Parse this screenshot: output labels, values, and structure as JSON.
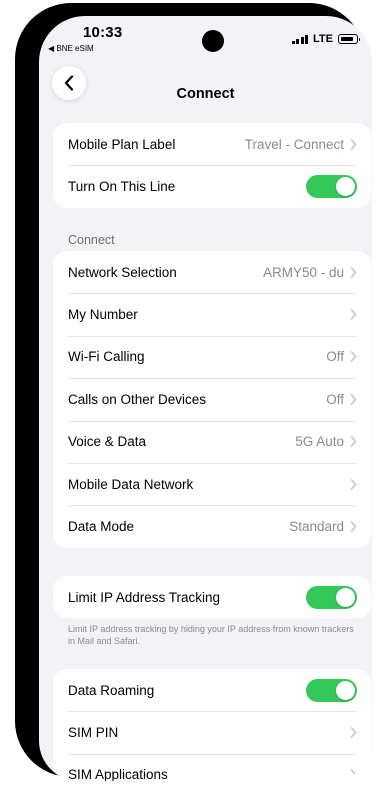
{
  "status_bar": {
    "time": "10:33",
    "back_app": "◀ BNE eSIM",
    "network": "LTE"
  },
  "nav": {
    "title": "Connect",
    "back_icon": "chevron-left-icon"
  },
  "plan_group": [
    {
      "label": "Mobile Plan Label",
      "value": "Travel - Connect",
      "type": "chevron"
    },
    {
      "label": "Turn On This Line",
      "type": "toggle",
      "on": true
    }
  ],
  "connect_section": {
    "header": "Connect",
    "items": [
      {
        "label": "Network Selection",
        "value": "ARMY50 - du"
      },
      {
        "label": "My Number",
        "value": ""
      },
      {
        "label": "Wi-Fi Calling",
        "value": "Off"
      },
      {
        "label": "Calls on Other Devices",
        "value": "Off"
      },
      {
        "label": "Voice & Data",
        "value": "5G Auto"
      },
      {
        "label": "Mobile Data Network",
        "value": ""
      },
      {
        "label": "Data Mode",
        "value": "Standard"
      }
    ]
  },
  "ip_tracking": {
    "label": "Limit IP Address Tracking",
    "on": true,
    "footer": "Limit IP address tracking by hiding your IP address from known trackers in Mail and Safari."
  },
  "roaming_group": [
    {
      "label": "Data Roaming",
      "type": "toggle",
      "on": true
    },
    {
      "label": "SIM PIN",
      "type": "chevron"
    },
    {
      "label": "SIM Applications",
      "type": "chevron"
    }
  ],
  "colors": {
    "toggle_on": "#34c759",
    "background": "#f2f2f7",
    "secondary_text": "#8a8a8e"
  }
}
